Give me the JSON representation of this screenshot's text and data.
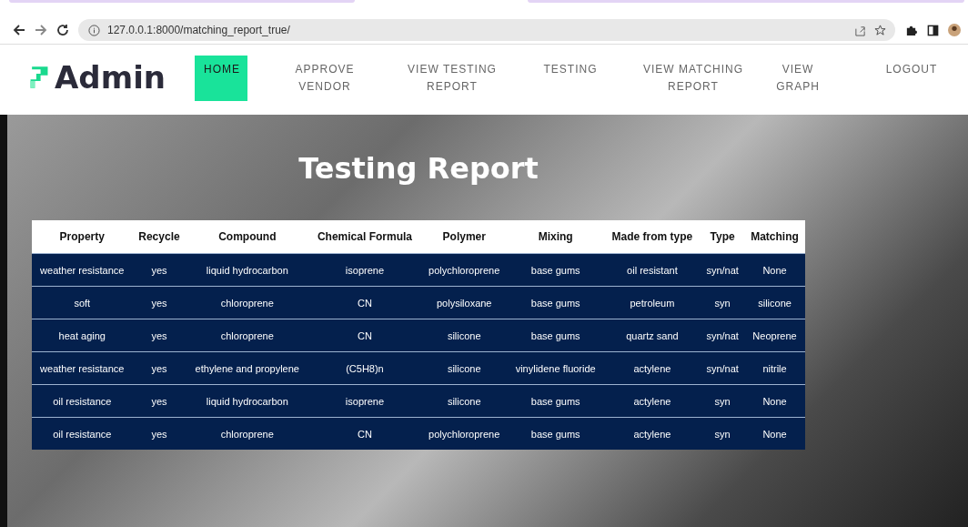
{
  "browser": {
    "url": "127.0.0.1:8000/matching_report_true/"
  },
  "nav": {
    "logo": "Admin",
    "items": [
      {
        "label": "HOME",
        "selected": true
      },
      {
        "label": "APPROVE VENDOR",
        "selected": false
      },
      {
        "label": "VIEW TESTING REPORT",
        "selected": false
      },
      {
        "label": "TESTING",
        "selected": false
      },
      {
        "label": "VIEW MATCHING REPORT",
        "selected": false
      },
      {
        "label": "VIEW GRAPH",
        "selected": false
      },
      {
        "label": "LOGOUT",
        "selected": false
      }
    ]
  },
  "page": {
    "title": "Testing Report"
  },
  "table": {
    "columns": [
      "Property",
      "Recycle",
      "Compound",
      "Chemical Formula",
      "Polymer",
      "Mixing",
      "Made from type",
      "Type",
      "Matching"
    ],
    "rows": [
      [
        "weather resistance",
        "yes",
        "liquid hydrocarbon",
        "isoprene",
        "polychloroprene",
        "base gums",
        "oil resistant",
        "syn/nat",
        "None"
      ],
      [
        "soft",
        "yes",
        "chloroprene",
        "CN",
        "polysiloxane",
        "base gums",
        "petroleum",
        "syn",
        "silicone"
      ],
      [
        "heat aging",
        "yes",
        "chloroprene",
        "CN",
        "silicone",
        "base gums",
        "quartz sand",
        "syn/nat",
        "Neoprene"
      ],
      [
        "weather resistance",
        "yes",
        "ethylene and propylene",
        "(C5H8)n",
        "silicone",
        "vinylidene fluoride",
        "actylene",
        "syn/nat",
        "nitrile"
      ],
      [
        "oil resistance",
        "yes",
        "liquid hydrocarbon",
        "isoprene",
        "silicone",
        "base gums",
        "actylene",
        "syn",
        "None"
      ],
      [
        "oil resistance",
        "yes",
        "chloroprene",
        "CN",
        "polychloroprene",
        "base gums",
        "actylene",
        "syn",
        "None"
      ]
    ]
  }
}
